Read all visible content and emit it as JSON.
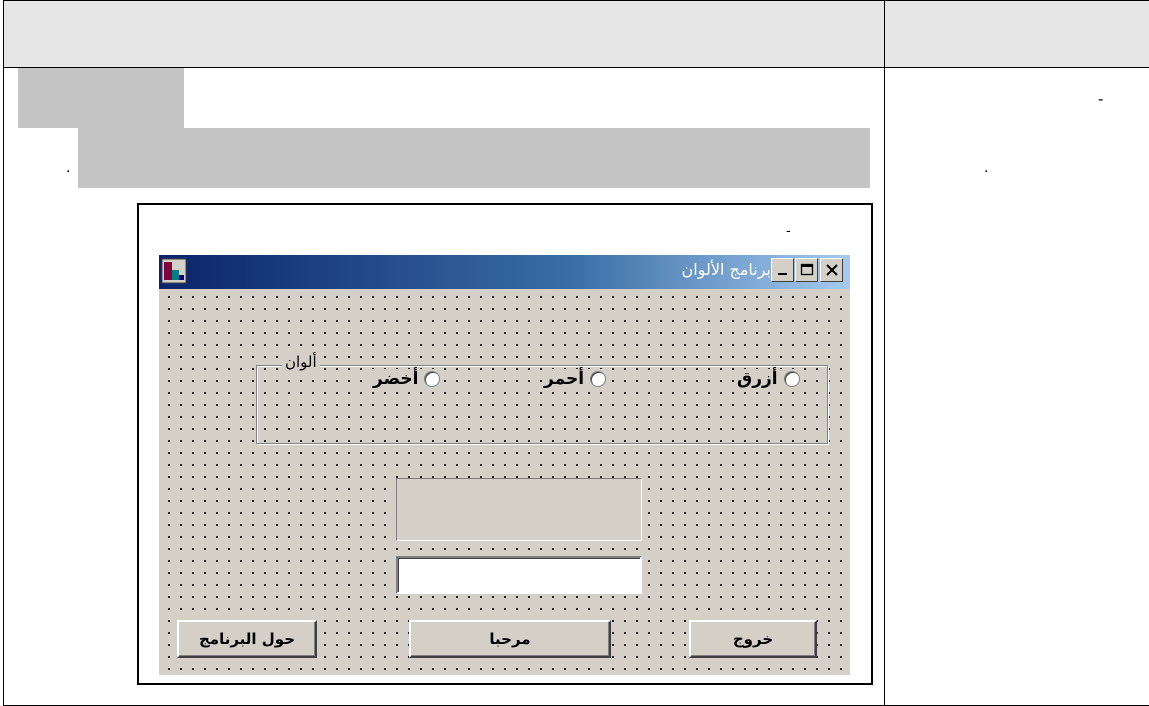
{
  "document": {
    "marks": {
      "right_col_dash": "-",
      "right_col_dot": ".",
      "left_dot": ".",
      "figure_dash": "-"
    }
  },
  "window": {
    "title": "برنامج الألوان",
    "buttons": {
      "close": "×",
      "maximize": "□",
      "minimize": "_"
    }
  },
  "form": {
    "group_label": "ألوان",
    "radios": [
      {
        "label": "أزرق",
        "checked": false
      },
      {
        "label": "أحمر",
        "checked": false
      },
      {
        "label": "أخضر",
        "checked": false
      }
    ],
    "label_box_text": "",
    "text_box_value": "",
    "buttons": {
      "exit": "خروج",
      "hello": "مرحبا",
      "about": "حول البرنامج"
    }
  },
  "colors": {
    "title_gradient_start": "#0a246a",
    "title_gradient_end": "#a6caf0",
    "form_face": "#d4d0c8",
    "doc_gray": "#c4c4c4",
    "header_gray": "#e6e6e6"
  },
  "icons": [
    "app-icon",
    "close-icon",
    "maximize-icon",
    "minimize-icon"
  ]
}
